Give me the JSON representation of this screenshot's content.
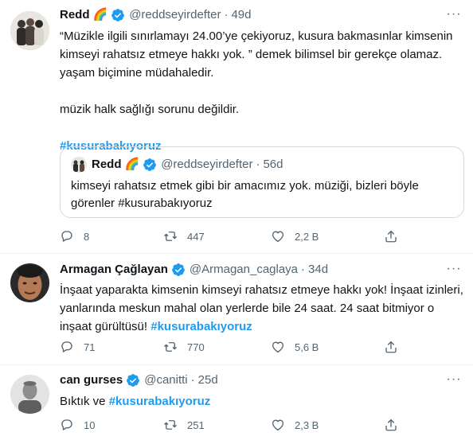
{
  "tweets": [
    {
      "name": "Redd",
      "emoji": "🌈",
      "handle": "@reddseyirdefter",
      "time": "49d",
      "text": "“Müzikle ilgili sınırlamayı 24.00’ye çekiyoruz, kusura bakmasınlar kimsenin kimseyi rahatsız etmeye hakkı yok. ” demek bilimsel bir gerekçe olamaz. yaşam biçimine müdahaledir.\n\nmüzik halk sağlığı sorunu değildir.\n\n",
      "hashtag": "#kusurabakıyoruz",
      "quote": {
        "name": "Redd",
        "emoji": "🌈",
        "handle": "@reddseyirdefter",
        "time": "56d",
        "text": "kimseyi rahatsız etmek gibi bir amacımız yok. müziği, bizleri böyle görenler #kusurabakıyoruz"
      },
      "replies": "8",
      "retweets": "447",
      "likes": "2,2 B"
    },
    {
      "name": "Armagan Çağlayan",
      "handle": "@Armagan_caglaya",
      "time": "34d",
      "text": "İnşaat yaparakta kimsenin kimseyi rahatsız etmeye hakkı yok! İnşaat izinleri, yanlarında meskun mahal olan yerlerde bile 24 saat. 24 saat bitmiyor o inşaat gürültüsü! ",
      "hashtag": "#kusurabakıyoruz",
      "replies": "71",
      "retweets": "770",
      "likes": "5,6 B"
    },
    {
      "name": "can gurses",
      "handle": "@canitti",
      "time": "25d",
      "text": "Bıktık ve ",
      "hashtag": "#kusurabakıyoruz",
      "replies": "10",
      "retweets": "251",
      "likes": "2,3 B"
    }
  ],
  "colors": {
    "accent": "#1d9bf0",
    "secondary_text": "#536471",
    "border": "#eff3f4"
  },
  "icons": [
    "more-icon",
    "verified-icon",
    "reply-icon",
    "retweet-icon",
    "like-icon",
    "share-icon"
  ]
}
